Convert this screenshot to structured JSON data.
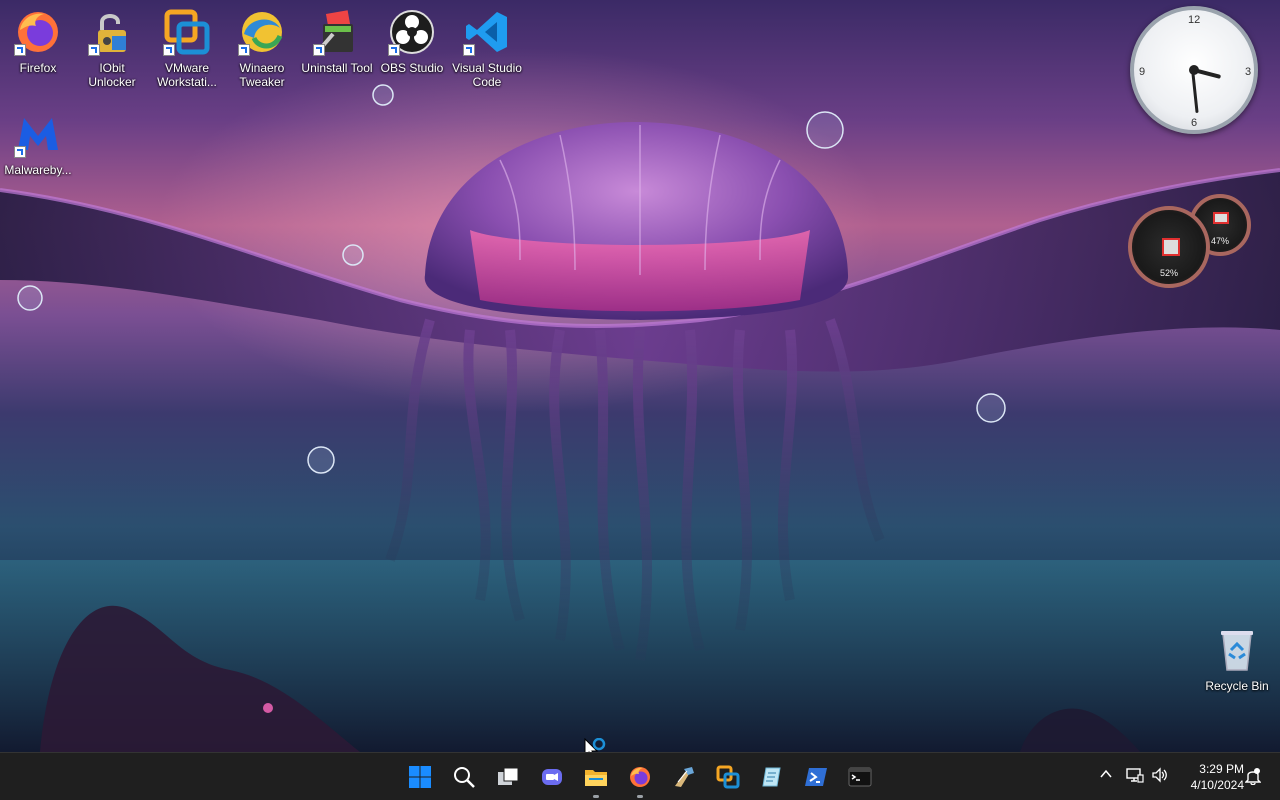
{
  "desktop": {
    "icons": [
      {
        "label": "Firefox",
        "icon": "firefox-icon"
      },
      {
        "label": "IObit Unlocker",
        "icon": "lock-icon"
      },
      {
        "label": "VMware Workstati...",
        "icon": "vmware-icon"
      },
      {
        "label": "Winaero Tweaker",
        "icon": "winaero-icon"
      },
      {
        "label": "Uninstall Tool",
        "icon": "uninstall-tool-icon"
      },
      {
        "label": "OBS Studio",
        "icon": "obs-icon"
      },
      {
        "label": "Visual Studio Code",
        "icon": "vscode-icon"
      },
      {
        "label": "Malwareby...",
        "icon": "malwarebytes-icon"
      },
      {
        "label": "Recycle Bin",
        "icon": "recycle-bin-icon"
      }
    ]
  },
  "gadgets": {
    "clock": {
      "numerals": [
        "12",
        "3",
        "6",
        "9"
      ],
      "hour": 3,
      "minute": 29
    },
    "cpu_meters": [
      {
        "value_label": "52%",
        "value": 0.52
      },
      {
        "value_label": "47%",
        "value": 0.47
      }
    ]
  },
  "taskbar": {
    "pinned": [
      "start-icon",
      "search-icon",
      "task-view-icon",
      "chat-icon",
      "file-explorer-icon",
      "firefox-icon",
      "winaero-icon",
      "vmware-icon",
      "notepad-icon",
      "powershell-icon",
      "terminal-icon"
    ],
    "tray": {
      "time": "3:29 PM",
      "date": "4/10/2024"
    }
  },
  "colors": {
    "taskbar": "#1f1f1f",
    "accent": "#0078d4"
  }
}
